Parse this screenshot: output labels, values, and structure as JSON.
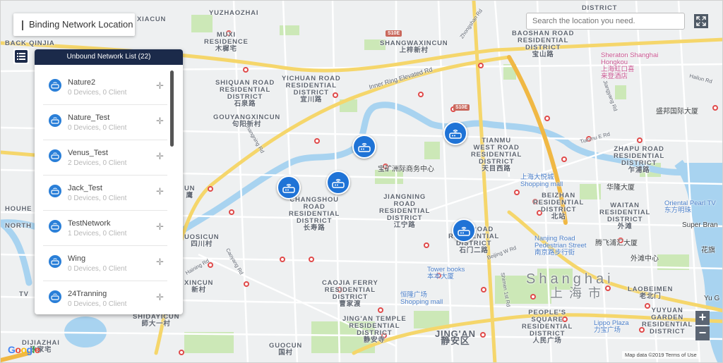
{
  "header": {
    "title": "Binding Network Location"
  },
  "panel": {
    "title": "Unbound Network List (22)",
    "items": [
      {
        "name": "Nature2",
        "stats": "0 Devices, 0 Client"
      },
      {
        "name": "Nature_Test",
        "stats": "0 Devices, 0 Client"
      },
      {
        "name": "Venus_Test",
        "stats": "2 Devices, 0 Client"
      },
      {
        "name": "Jack_Test",
        "stats": "0 Devices, 0 Client"
      },
      {
        "name": "TestNetwork",
        "stats": "1 Devices, 0 Client"
      },
      {
        "name": "Wing",
        "stats": "0 Devices, 0 Client"
      },
      {
        "name": "24Tranning",
        "stats": "0 Devices, 0 Client"
      }
    ]
  },
  "search": {
    "placeholder": "Search the location you need."
  },
  "map": {
    "zoom_in": "+",
    "zoom_out": "−",
    "google": "Google",
    "attribution": "Map data ©2019   Terms of Use",
    "big_label_en": "Shanghai",
    "big_label_cn": "上 海 市",
    "shields": [
      "S10E",
      "S10E"
    ],
    "districts": [
      {
        "id": "d1",
        "text": "YUZHAOZHAI"
      },
      {
        "id": "d2",
        "text": "MUXI\nRESIDENCE\n木樨宅"
      },
      {
        "id": "d3",
        "text": "XIACUN"
      },
      {
        "id": "d4",
        "text": "SHANGWAXINCUN\n上梓新村"
      },
      {
        "id": "d5",
        "text": "DISTRICT"
      },
      {
        "id": "d6",
        "text": "BAOSHAN ROAD\nRESIDENTIAL\nDISTRICT\n宝山路"
      },
      {
        "id": "d7",
        "text": "SHIQUAN ROAD\nRESIDENTIAL\nDISTRICT\n石泉路"
      },
      {
        "id": "d8",
        "text": "YICHUAN ROAD\nRESIDENTIAL\nDISTRICT\n宜川路"
      },
      {
        "id": "d9",
        "text": "GOUYANGXINCUN\n句阳新村"
      },
      {
        "id": "d10",
        "text": "TIANMU\nWEST ROAD\nRESIDENTIAL\nDISTRICT\n天目西路"
      },
      {
        "id": "d11",
        "text": "ZHAPU ROAD\nRESIDENTIAL\nDISTRICT\n乍浦路"
      },
      {
        "id": "d12",
        "text": "CHANGSHOU\nROAD\nRESIDENTIAL\nDISTRICT\n长寿路"
      },
      {
        "id": "d13",
        "text": "JIANGNING\nROAD\nRESIDENTIAL\nDISTRICT\n江宁路"
      },
      {
        "id": "d14",
        "text": "BEIZHAN\nRESIDENTIAL\nDISTRICT\n北站"
      },
      {
        "id": "d15",
        "text": "WAITAN\nRESIDENTIAL\nDISTRICT\n外滩"
      },
      {
        "id": "d16",
        "text": "2ND ROAD\nRESIDENTIAL\nDISTRICT\n石门二路"
      },
      {
        "id": "d17",
        "text": "CAOJIA FERRY\nRESIDENTIAL\nDISTRICT\n曹家渡"
      },
      {
        "id": "d18",
        "text": "JING'AN TEMPLE\nRESIDENTIAL\nDISTRICT\n静安寺"
      },
      {
        "id": "d19",
        "text": "PEOPLE'S\nSQUARE\nRESIDENTIAL\nDISTRICT\n人民广场"
      },
      {
        "id": "d20",
        "text": "LAOBEIMEN\n老北门"
      },
      {
        "id": "d21",
        "text": "YUYUAN\nGARDEN\nRESIDENTIAL\nDISTRICT"
      },
      {
        "id": "d22",
        "text": "JING'AN\n静安区"
      },
      {
        "id": "d23",
        "text": "GUOCUN\n国村"
      },
      {
        "id": "d24",
        "text": "SHIDAYICUN\n師大一村"
      },
      {
        "id": "d25",
        "text": "DIJIAZHAI\n狄家宅"
      },
      {
        "id": "d26",
        "text": "BACK QINJIA"
      },
      {
        "id": "d27",
        "text": "HOUHE"
      },
      {
        "id": "d28",
        "text": "NORTH"
      },
      {
        "id": "d29",
        "text": "TV"
      },
      {
        "id": "d30",
        "text": "UN\n鹰"
      },
      {
        "id": "d31",
        "text": "XINCUN\n新村"
      },
      {
        "id": "d32",
        "text": "UOSICUN\n四川村"
      }
    ],
    "pois": [
      {
        "id": "p1",
        "text": "Sheraton Shanghai\nHongkou\n上海虹口喜\n来登酒店"
      },
      {
        "id": "p2",
        "text": "盛邦国际大厦"
      },
      {
        "id": "p3",
        "text": "宝矿洲际商务中心"
      },
      {
        "id": "p4",
        "text": "上海大悦城\nShopping mall"
      },
      {
        "id": "p5",
        "text": "华隆大厦"
      },
      {
        "id": "p6",
        "text": "Oriental Pearl TV\n东方明珠"
      },
      {
        "id": "p7",
        "text": "Super Bran"
      },
      {
        "id": "p8",
        "text": "Nanjing Road\nPedestrian Street\n南京路步行街"
      },
      {
        "id": "p9",
        "text": "腾飞浦汇大厦"
      },
      {
        "id": "p10",
        "text": "外滩中心"
      },
      {
        "id": "p11",
        "text": "Tower books\n本本大厦"
      },
      {
        "id": "p12",
        "text": "恒隆广场\nShopping mall"
      },
      {
        "id": "p13",
        "text": "Lippo Plaza\n力宝广场"
      },
      {
        "id": "p14",
        "text": "花旗"
      },
      {
        "id": "p15",
        "text": "Yu G"
      }
    ],
    "roads": [
      {
        "id": "r1",
        "text": "Inner Ring Elevated Rd"
      },
      {
        "id": "r2",
        "text": "Beijing W Rd"
      },
      {
        "id": "r3",
        "text": "Tianmu E Rd"
      },
      {
        "id": "r4",
        "text": "Haining Rd"
      },
      {
        "id": "r5",
        "text": "Changning Rd"
      },
      {
        "id": "r6",
        "text": "Caoyang Rd"
      },
      {
        "id": "r7",
        "text": "Zhongshan Rd"
      },
      {
        "id": "r8",
        "text": "Hailun Rd"
      },
      {
        "id": "r9",
        "text": "Jiangyang Rd"
      },
      {
        "id": "r10",
        "text": "Shimen 1st Rd"
      }
    ],
    "markers": [
      {
        "id": "m1",
        "name": "router-marker-1"
      },
      {
        "id": "m2",
        "name": "router-marker-2"
      },
      {
        "id": "m3",
        "name": "router-marker-3"
      },
      {
        "id": "m4",
        "name": "router-marker-4"
      },
      {
        "id": "m5",
        "name": "router-marker-5"
      }
    ]
  },
  "colors": {
    "panel_header": "#1b2a4a",
    "marker_blue": "#1f73d6",
    "highway_yellow": "#f5d66b",
    "water": "#a8d3f0",
    "park": "#c8e5b4"
  }
}
